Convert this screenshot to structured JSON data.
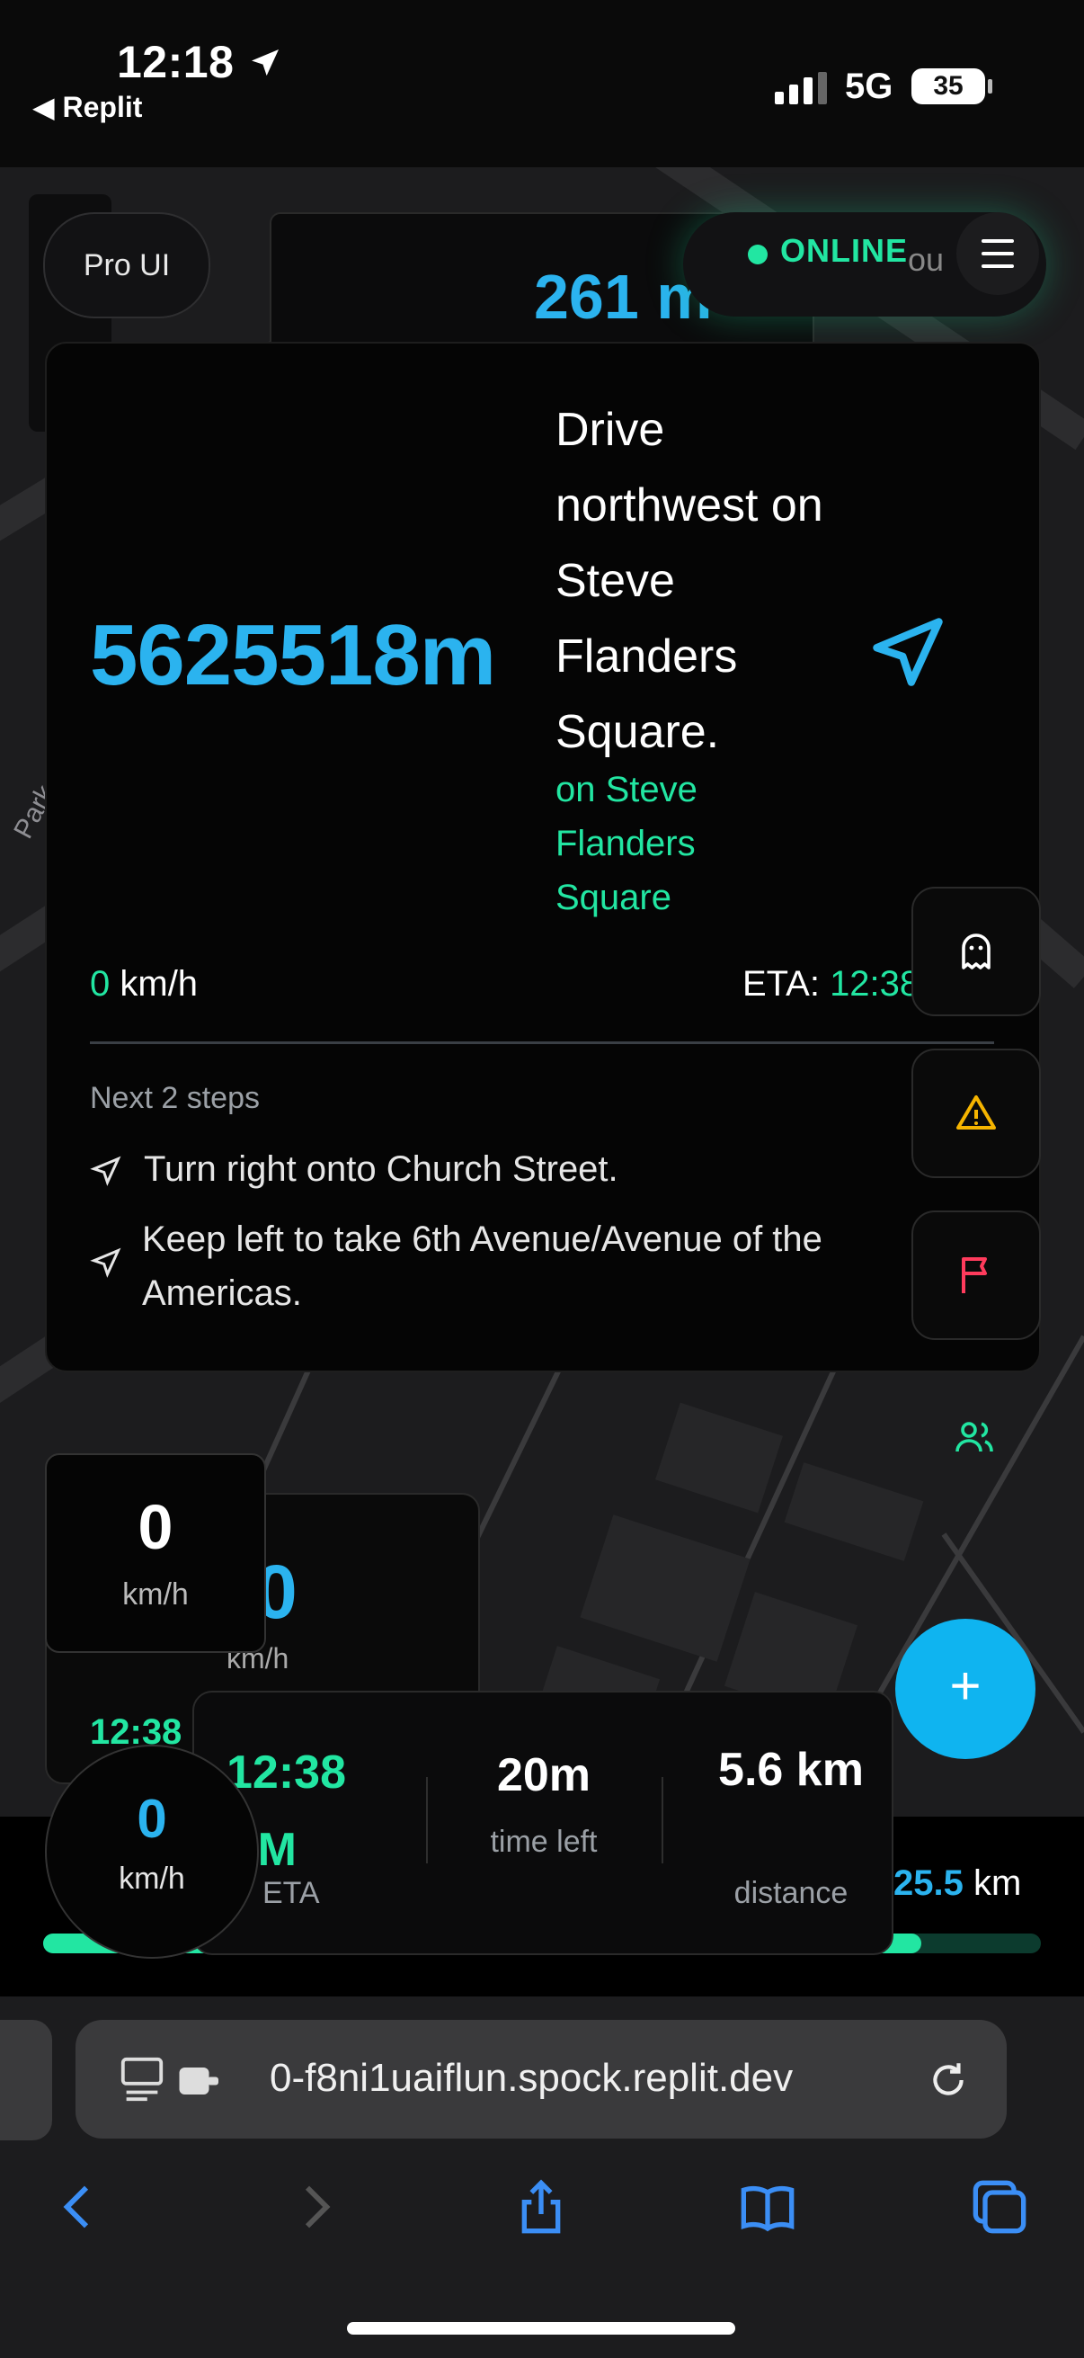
{
  "status_bar": {
    "time": "12:18",
    "back_label": "◀ Replit",
    "network": "5G",
    "battery": "35"
  },
  "header": {
    "pro_ui_label": "Pro UI",
    "top_distance": "261 m",
    "online_label": "ONLINE",
    "partial_text": "ou"
  },
  "map": {
    "street_label": "Park"
  },
  "navigation": {
    "distance": "5625518m",
    "instruction": "Drive northwest on Steve Flanders Square.",
    "sub_instruction": "on Steve Flanders Square",
    "speed_value": "0",
    "speed_unit": "km/h",
    "eta_label": "ETA:",
    "eta_value": "12:38",
    "next_steps_title": "Next 2 steps",
    "steps": [
      "Turn right onto Church Street.",
      "Keep left to take 6th Avenue/Avenue of the Americas."
    ]
  },
  "side_buttons": [
    "ghost-icon",
    "warning-icon",
    "flag-icon",
    "users-icon"
  ],
  "colors": {
    "accent_blue": "#2bb3ef",
    "accent_green": "#22e6a2",
    "warning": "#f5b400",
    "flag": "#ff3b5c"
  },
  "speed_widget_back": {
    "value": "0",
    "unit": "km/h"
  },
  "speed_widget": {
    "value": "0",
    "unit": "km/h"
  },
  "eta_peek": "12:38",
  "fab": {
    "symbol": "+"
  },
  "trip": {
    "eta_value": "12:38 PM",
    "eta_label": "ETA",
    "time_value": "20m",
    "time_label": "time left",
    "distance_value": "5.6 km",
    "distance_label": "distance",
    "remaining_value": "25.5",
    "remaining_unit": "km",
    "progress": 0.88
  },
  "speed_circle": {
    "value": "0",
    "unit": "km/h"
  },
  "browser": {
    "url": "0-f8ni1uaiflun.spock.replit.dev"
  }
}
